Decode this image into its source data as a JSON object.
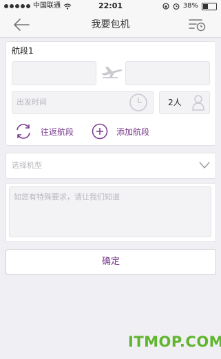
{
  "status_bar": {
    "carrier": "中国联通",
    "time": "22:01",
    "battery": "38%",
    "battery_level": 0.38
  },
  "nav": {
    "title": "我要包机"
  },
  "segment": {
    "title": "航段1",
    "departure_placeholder": "",
    "arrival_placeholder": "",
    "time_placeholder": "出发时间",
    "passengers": "2人"
  },
  "actions": {
    "round_trip_label": "往返航段",
    "add_segment_label": "添加航段"
  },
  "aircraft": {
    "placeholder": "选择机型"
  },
  "remarks": {
    "placeholder": "如您有特殊要求，请让我们知道"
  },
  "confirm": {
    "label": "确定"
  },
  "watermark": {
    "text": "ITMOP.COM"
  },
  "colors": {
    "accent": "#7a3b8f",
    "watermark": "#5fb52d",
    "background": "#efeff4"
  },
  "icons": [
    "back-arrow-icon",
    "filter-clock-icon",
    "plane-icon",
    "clock-icon",
    "person-icon",
    "round-trip-icon",
    "plus-circle-icon",
    "chevron-down-icon",
    "signal-dots-icon",
    "wifi-icon",
    "battery-icon",
    "lock-rotation-icon",
    "alarm-icon"
  ]
}
